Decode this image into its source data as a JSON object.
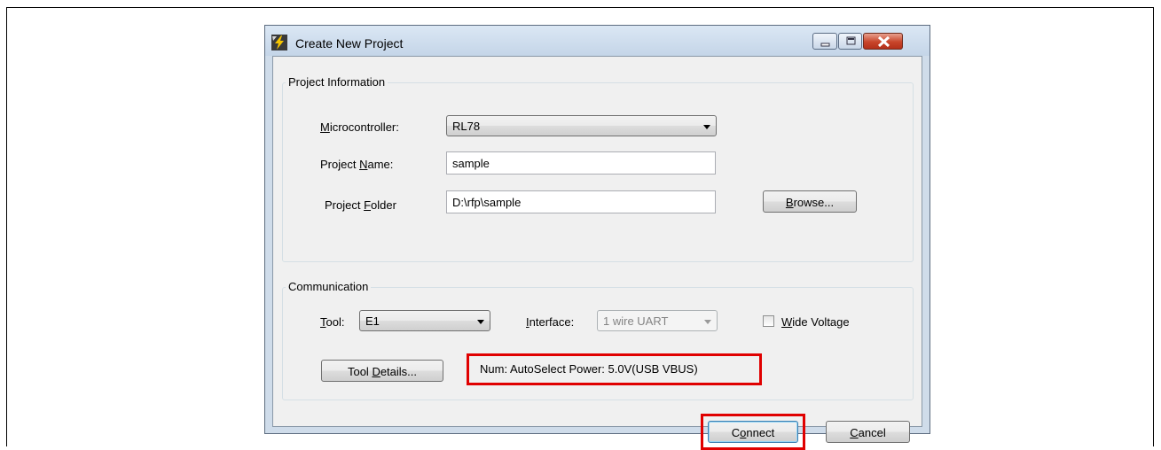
{
  "window": {
    "title": "Create New Project"
  },
  "project_information": {
    "group_label": "Project Information",
    "microcontroller_label_pre": "",
    "microcontroller_label_u": "M",
    "microcontroller_label_post": "icrocontroller:",
    "microcontroller_value": "RL78",
    "project_name_label_pre": "Project ",
    "project_name_label_u": "N",
    "project_name_label_post": "ame:",
    "project_name_value": "sample",
    "project_folder_label_pre": "Project ",
    "project_folder_label_u": "F",
    "project_folder_label_post": "older",
    "project_folder_value": "D:\\rfp\\sample",
    "browse_u": "B",
    "browse_post": "rowse..."
  },
  "communication": {
    "group_label": "Communication",
    "tool_label_u": "T",
    "tool_label_post": "ool:",
    "tool_value": "E1",
    "interface_label_u": "I",
    "interface_label_post": "nterface:",
    "interface_value": "1 wire UART",
    "wide_voltage_u": "W",
    "wide_voltage_post": "ide Voltage",
    "wide_voltage_checked": false,
    "tool_details_pre": "Tool ",
    "tool_details_u": "D",
    "tool_details_post": "etails...",
    "status_text": "Num: AutoSelect  Power: 5.0V(USB VBUS)"
  },
  "buttons": {
    "connect_pre": "C",
    "connect_u": "o",
    "connect_post": "nnect",
    "cancel_u": "C",
    "cancel_post": "ancel"
  },
  "colors": {
    "highlight": "#e00000"
  }
}
